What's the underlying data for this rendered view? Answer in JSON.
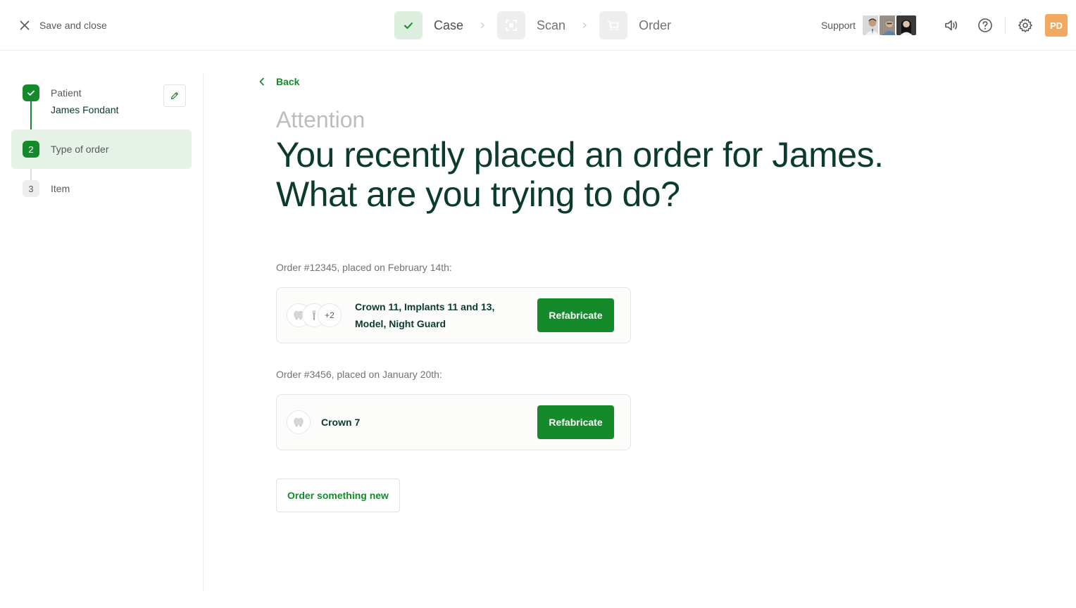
{
  "topbar": {
    "save_close_label": "Save and close",
    "steps": [
      {
        "label": "Case",
        "state": "done",
        "icon": "check-icon"
      },
      {
        "label": "Scan",
        "state": "todo",
        "icon": "scan-icon"
      },
      {
        "label": "Order",
        "state": "todo",
        "icon": "cart-icon"
      }
    ],
    "support_label": "Support",
    "user_initials": "PD"
  },
  "sidebar": {
    "steps": [
      {
        "number": "",
        "title": "Patient",
        "value": "James Fondant",
        "state": "done"
      },
      {
        "number": "2",
        "title": "Type of order",
        "state": "current"
      },
      {
        "number": "3",
        "title": "Item",
        "state": "todo"
      }
    ]
  },
  "main": {
    "back_label": "Back",
    "attention": "Attention",
    "headline_line1": "You recently placed an order for James.",
    "headline_line2": "What are you trying to do?",
    "orders": [
      {
        "caption": "Order #12345, placed on February 14th:",
        "items_line1": "Crown 11, Implants 11 and 13,",
        "items_line2": "Model, Night Guard",
        "extra_count": "+2",
        "button_label": "Refabricate"
      },
      {
        "caption": "Order #3456, placed on January 20th:",
        "items_line1": "Crown 7",
        "button_label": "Refabricate"
      }
    ],
    "new_order_label": "Order something new"
  },
  "colors": {
    "brand_green": "#158a2a",
    "text_dark": "#0b3b2a",
    "current_step_bg": "#e6f2e7",
    "user_badge": "#f0a95e"
  }
}
